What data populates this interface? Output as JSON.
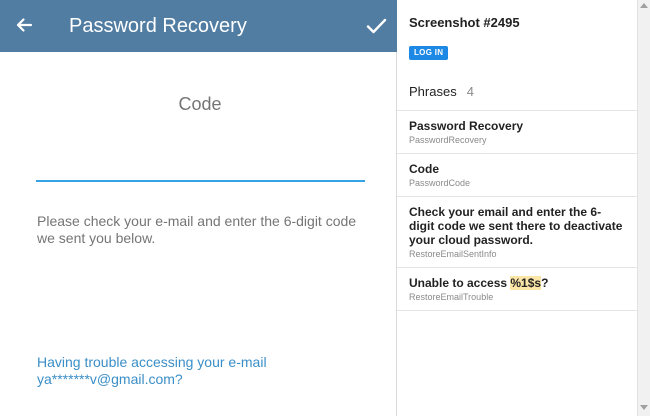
{
  "screen": {
    "title": "Password Recovery",
    "code_label": "Code",
    "code_input": {
      "value": "",
      "placeholder": ""
    },
    "info_text": "Please check your e-mail and enter the 6-digit code we sent you below.",
    "trouble_link": "Having trouble accessing your e-mail ya*******v@gmail.com?",
    "icons": {
      "back": "arrow-left",
      "done": "checkmark"
    },
    "colors": {
      "appbar": "#527da3",
      "accent": "#37a3e6",
      "link": "#3a8ec7"
    }
  },
  "panel": {
    "screenshot_title": "Screenshot #2495",
    "login_label": "LOG IN",
    "phrases_label": "Phrases",
    "phrases_count": "4",
    "phrases": [
      {
        "text": "Password Recovery",
        "key": "PasswordRecovery"
      },
      {
        "text": "Code",
        "key": "PasswordCode"
      },
      {
        "text": "Check your email and enter the 6-digit code we sent there to deactivate your cloud password.",
        "key": "RestoreEmailSentInfo"
      },
      {
        "text_prefix": "Unable to access ",
        "text_placeholder": "%1$s",
        "text_suffix": "?",
        "key": "RestoreEmailTrouble"
      }
    ]
  }
}
